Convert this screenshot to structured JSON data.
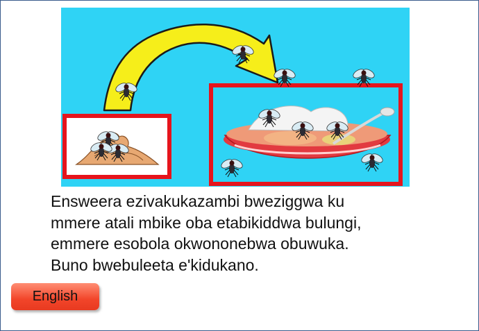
{
  "illustration": {
    "background_color": "#2fd3f5",
    "frame_color": "#e6141c",
    "arrow_color": "#f6ee1a",
    "icons": [
      "fly-icon",
      "food-dish-icon",
      "contaminated-feces-icon"
    ]
  },
  "caption": {
    "lines": [
      "Ensweera ezivakukazambi bweziggwa ku",
      "mmere atali mbike oba etabikiddwa bulungi,",
      "emmere esobola okwononebwa obuwuka.",
      "Buno bwebuleeta e'kidukano."
    ]
  },
  "language_button": {
    "label": "English",
    "color": "#f2452a"
  }
}
